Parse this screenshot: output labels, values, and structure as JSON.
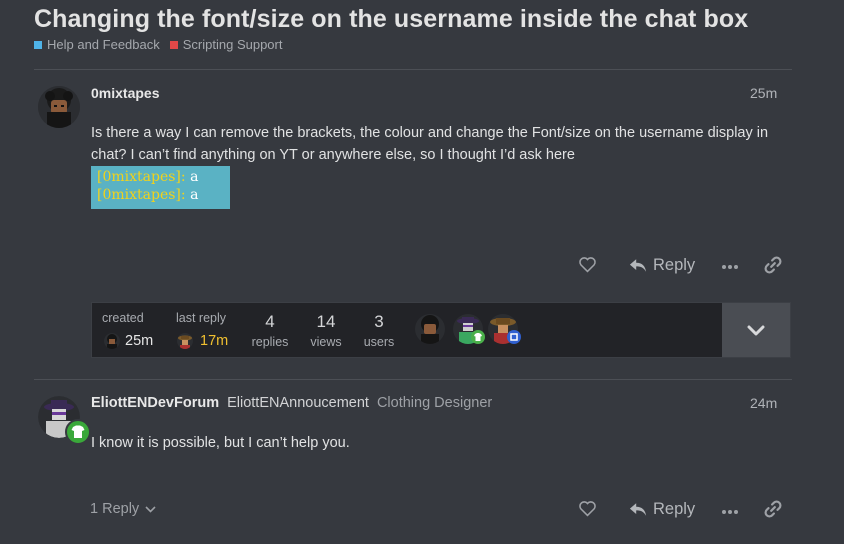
{
  "topic": {
    "title": "Changing the font/size on the username inside the chat box",
    "categories": [
      {
        "label": "Help and Feedback",
        "color": "#4fb3e8"
      },
      {
        "label": "Scripting Support",
        "color": "#e04848"
      }
    ]
  },
  "post1": {
    "username": "0mixtapes",
    "time": "25m",
    "text": "Is there a way I can remove the brackets, the colour and change the Font/size on the username display in chat? I can’t find anything on YT or anywhere else, so I thought I’d ask here",
    "chat_lines": [
      {
        "name": "[0mixtapes]:",
        "msg": "a"
      },
      {
        "name": "[0mixtapes]:",
        "msg": "a"
      }
    ],
    "reply_label": "Reply"
  },
  "meta": {
    "created_label": "created",
    "created_time": "25m",
    "last_reply_label": "last reply",
    "last_reply_time": "17m",
    "replies_count": "4",
    "replies_label": "replies",
    "views_count": "14",
    "views_label": "views",
    "users_count": "3",
    "users_label": "users"
  },
  "post2": {
    "username": "EliottENDevForum",
    "name": "EliottENAnnoucement",
    "user_title": "Clothing Designer",
    "time": "24m",
    "text": "I know it is possible, but I can’t help you.",
    "replies_toggle": "1 Reply",
    "reply_label": "Reply"
  },
  "icons": {
    "like": "heart-icon",
    "reply": "reply-arrow-icon",
    "more": "ellipsis-icon",
    "share": "link-icon",
    "expand": "chevron-down-icon"
  }
}
